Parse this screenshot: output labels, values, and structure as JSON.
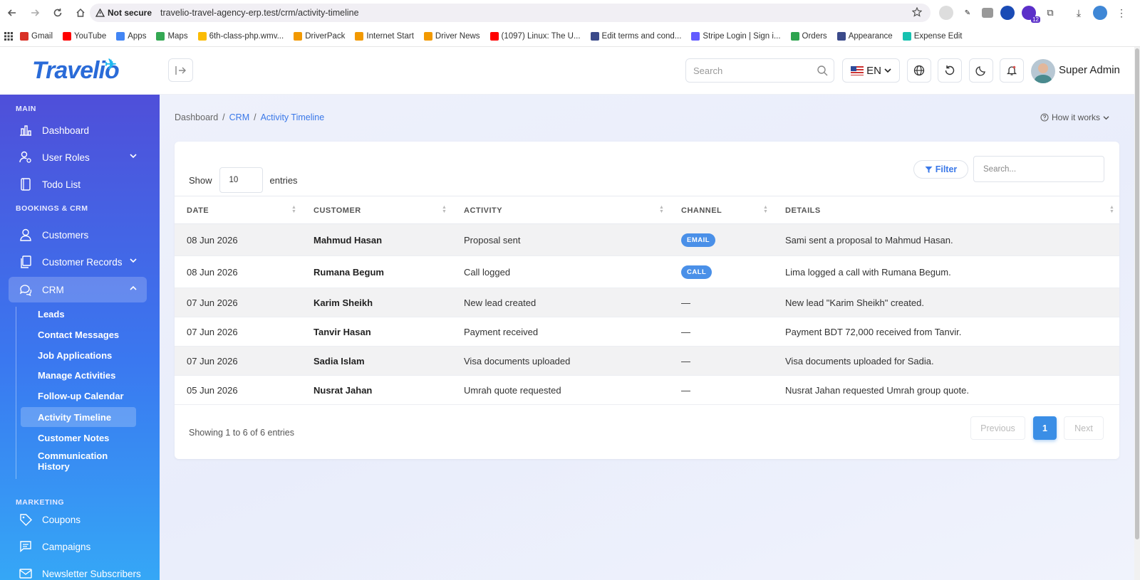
{
  "browser": {
    "security_label": "Not secure",
    "url": "travelio-travel-agency-erp.test/crm/activity-timeline",
    "bookmarks": [
      {
        "label": "Gmail",
        "color": "#d93025"
      },
      {
        "label": "YouTube",
        "color": "#ff0000"
      },
      {
        "label": "Apps",
        "color": "#4285f4"
      },
      {
        "label": "Maps",
        "color": "#34a853"
      },
      {
        "label": "6th-class-php.wmv...",
        "color": "#fbbc04"
      },
      {
        "label": "DriverPack",
        "color": "#f29900"
      },
      {
        "label": "Internet Start",
        "color": "#f29900"
      },
      {
        "label": "Driver News",
        "color": "#f29900"
      },
      {
        "label": "(1097) Linux: The U...",
        "color": "#ff0000"
      },
      {
        "label": "Edit terms and cond...",
        "color": "#3b4a8a"
      },
      {
        "label": "Stripe Login | Sign i...",
        "color": "#635bff"
      },
      {
        "label": "Orders",
        "color": "#2ea44f"
      },
      {
        "label": "Appearance",
        "color": "#3b4a8a"
      },
      {
        "label": "Expense Edit",
        "color": "#16c2b0"
      }
    ],
    "extension_badge": "12"
  },
  "header": {
    "logo_text": "Travelio",
    "search_placeholder": "Search",
    "language": "EN",
    "user_name": "Super Admin"
  },
  "sidebar": {
    "sections": {
      "main": "MAIN",
      "bookings": "BOOKINGS & CRM",
      "marketing": "MARKETING"
    },
    "items": {
      "dashboard": "Dashboard",
      "user_roles": "User Roles",
      "todo": "Todo List",
      "customers": "Customers",
      "customer_records": "Customer Records",
      "crm": "CRM",
      "coupons": "Coupons",
      "campaigns": "Campaigns",
      "newsletter": "Newsletter Subscribers"
    },
    "crm_sub": {
      "leads": "Leads",
      "contact_messages": "Contact Messages",
      "job_applications": "Job Applications",
      "manage_activities": "Manage Activities",
      "followup_calendar": "Follow-up Calendar",
      "activity_timeline": "Activity Timeline",
      "customer_notes": "Customer Notes",
      "comm_history_1": "Communication",
      "comm_history_2": "History"
    }
  },
  "page": {
    "breadcrumb": [
      "Dashboard",
      "CRM",
      "Activity Timeline"
    ],
    "how_it_works": "How it works",
    "show_label": "Show",
    "entries_value": "10",
    "entries_label": "entries",
    "filter_label": "Filter",
    "table_search_placeholder": "Search...",
    "columns": [
      "DATE",
      "CUSTOMER",
      "ACTIVITY",
      "CHANNEL",
      "DETAILS"
    ],
    "rows": [
      {
        "date": "08 Jun 2026",
        "customer": "Mahmud Hasan",
        "activity": "Proposal sent",
        "channel": "EMAIL",
        "details": "Sami sent a proposal to Mahmud Hasan."
      },
      {
        "date": "08 Jun 2026",
        "customer": "Rumana Begum",
        "activity": "Call logged",
        "channel": "CALL",
        "details": "Lima logged a call with Rumana Begum."
      },
      {
        "date": "07 Jun 2026",
        "customer": "Karim Sheikh",
        "activity": "New lead created",
        "channel": "—",
        "details": "New lead \"Karim Sheikh\" created."
      },
      {
        "date": "07 Jun 2026",
        "customer": "Tanvir Hasan",
        "activity": "Payment received",
        "channel": "—",
        "details": "Payment BDT 72,000 received from Tanvir."
      },
      {
        "date": "07 Jun 2026",
        "customer": "Sadia Islam",
        "activity": "Visa documents uploaded",
        "channel": "—",
        "details": "Visa documents uploaded for Sadia."
      },
      {
        "date": "05 Jun 2026",
        "customer": "Nusrat Jahan",
        "activity": "Umrah quote requested",
        "channel": "—",
        "details": "Nusrat Jahan requested Umrah group quote."
      }
    ],
    "showing": "Showing 1 to 6 of 6 entries",
    "pagination": {
      "previous": "Previous",
      "current": "1",
      "next": "Next"
    }
  },
  "colors": {
    "accent": "#3a78e8",
    "sidebar_top": "#4f4fd9",
    "sidebar_bottom": "#35a7f6",
    "badge": "#4a90e8"
  }
}
